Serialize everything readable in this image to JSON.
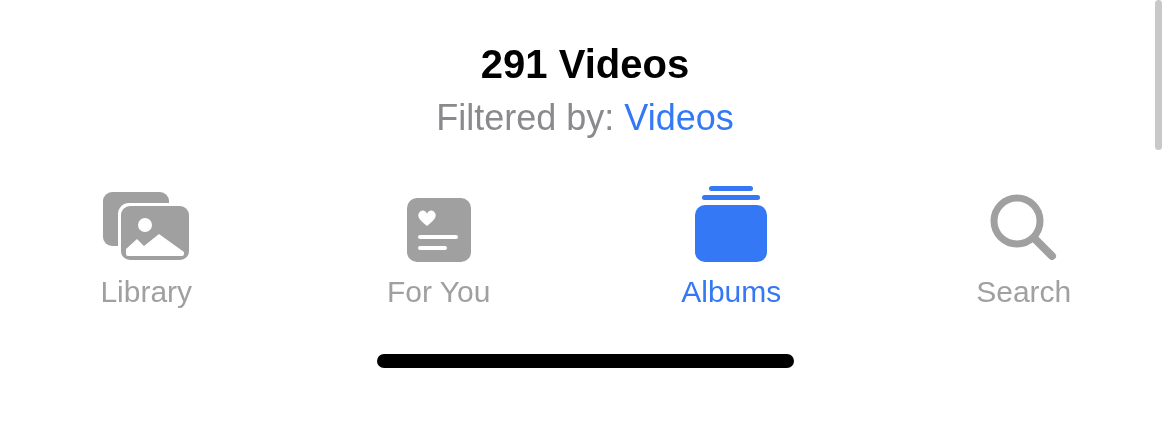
{
  "header": {
    "title": "291 Videos",
    "filter_label": "Filtered by:",
    "filter_value": "Videos"
  },
  "tabs": [
    {
      "kind": "library",
      "label": "Library",
      "selected": false
    },
    {
      "kind": "for_you",
      "label": "For You",
      "selected": false
    },
    {
      "kind": "albums",
      "label": "Albums",
      "selected": true
    },
    {
      "kind": "search",
      "label": "Search",
      "selected": false
    }
  ]
}
